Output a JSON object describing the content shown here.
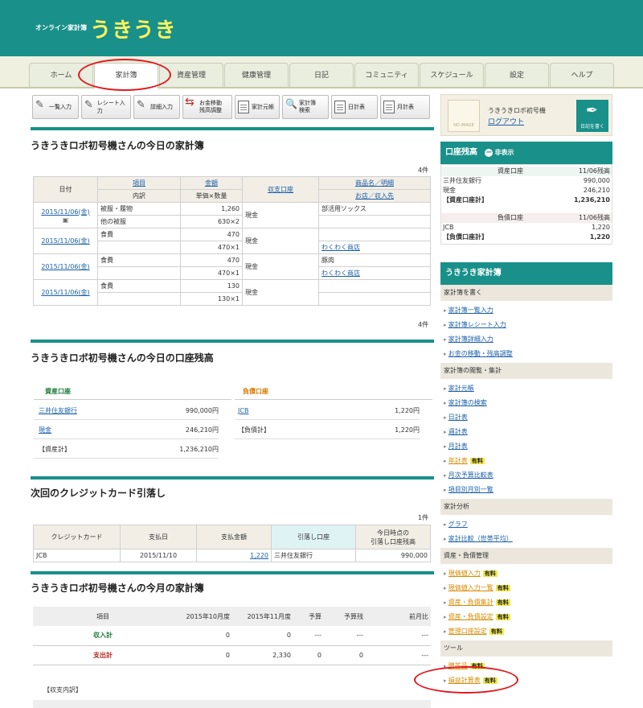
{
  "header": {
    "sub": "オンライン家計簿",
    "logo": "うきうき"
  },
  "nav": [
    "ホーム",
    "家計簿",
    "資産管理",
    "健康管理",
    "日記",
    "コミュニティ",
    "スケジュール",
    "設定",
    "ヘルプ"
  ],
  "toolbar": [
    "一覧入力",
    "レシート入力",
    "詳細入力",
    "お金移動\n残高調整",
    "家計元帳",
    "家計簿\n検索",
    "日計表",
    "月計表"
  ],
  "profile": {
    "no_image": "NO IMAGE",
    "name": "うきうきロボ初号機",
    "logout": "ログアウト",
    "write_diary": "日記を書く"
  },
  "today": {
    "title": "うきうきロボ初号機さんの今日の家計簿",
    "count": "4件",
    "headers": {
      "date": "日付",
      "item": "項目",
      "detail": "内訳",
      "amount": "金額",
      "unit": "単価×数量",
      "account": "収支口座",
      "product": "商品名／明細",
      "store": "お店／収入先"
    },
    "rows": [
      {
        "date": "2015/11/06(金)",
        "item": "被服・履物",
        "detail": "他の被服",
        "amount": "1,260",
        "unit": "630×2",
        "account": "現金",
        "product": "部活用ソックス",
        "store": ""
      },
      {
        "date": "2015/11/06(金)",
        "item": "食費",
        "detail": "",
        "amount": "470",
        "unit": "470×1",
        "account": "現金",
        "product": "",
        "store": "わくわく商店"
      },
      {
        "date": "2015/11/06(金)",
        "item": "食費",
        "detail": "",
        "amount": "470",
        "unit": "470×1",
        "account": "現金",
        "product": "豚肉",
        "store": "わくわく商店"
      },
      {
        "date": "2015/11/06(金)",
        "item": "食費",
        "detail": "",
        "amount": "130",
        "unit": "130×1",
        "account": "現金",
        "product": "",
        "store": ""
      }
    ]
  },
  "balance": {
    "title": "うきうきロボ初号機さんの今日の口座残高",
    "assets_head": "資産口座",
    "liab_head": "負債口座",
    "assets": [
      {
        "name": "三井住友銀行",
        "value": "990,000円"
      },
      {
        "name": "現金",
        "value": "246,210円"
      }
    ],
    "assets_total": {
      "name": "【資産計】",
      "value": "1,236,210円"
    },
    "liabs": [
      {
        "name": "JCB",
        "value": "1,220円"
      }
    ],
    "liabs_total": {
      "name": "【負債計】",
      "value": "1,220円"
    }
  },
  "credit": {
    "title": "次回のクレジットカード引落し",
    "count": "1件",
    "headers": [
      "クレジットカード",
      "支払日",
      "支払金額",
      "引落し口座",
      "今日時点の\n引落し口座残高"
    ],
    "row": [
      "JCB",
      "2015/11/10",
      "1,220",
      "三井住友銀行",
      "990,000"
    ]
  },
  "monthly": {
    "title": "うきうきロボ初号機さんの今月の家計簿",
    "headers": [
      "項目",
      "2015年10月度",
      "2015年11月度",
      "予算",
      "予算残",
      "前月比"
    ],
    "rows": [
      [
        "収入計",
        "0",
        "0",
        "---",
        "---",
        "---"
      ],
      [
        "支出計",
        "0",
        "2,330",
        "0",
        "0",
        "---"
      ]
    ],
    "breakdown": "【収支内訳】"
  },
  "sidebar_balance": {
    "title": "口座残高",
    "toggle": "非表示",
    "asset_head": [
      "資産口座",
      "11/06残高"
    ],
    "assets": [
      [
        "三井住友銀行",
        "990,000"
      ],
      [
        "現金",
        "246,210"
      ]
    ],
    "asset_total": [
      "【資産口座計】",
      "1,236,210"
    ],
    "liab_head": [
      "負債口座",
      "11/06残高"
    ],
    "liabs": [
      [
        "JCB",
        "1,220"
      ]
    ],
    "liab_total": [
      "【負債口座計】",
      "1,220"
    ]
  },
  "sidebar_menu": {
    "title": "うきうき家計簿",
    "groups": [
      {
        "cat": "家計簿を書く",
        "items": [
          {
            "label": "家計簿一覧入力"
          },
          {
            "label": "家計簿レシート入力"
          },
          {
            "label": "家計簿詳細入力"
          },
          {
            "label": "お金の移動・残高調整"
          }
        ]
      },
      {
        "cat": "家計簿の閲覧・集計",
        "items": [
          {
            "label": "家計元帳"
          },
          {
            "label": "家計簿の検索"
          },
          {
            "label": "日計表"
          },
          {
            "label": "週計表"
          },
          {
            "label": "月計表"
          },
          {
            "label": "年計表",
            "paid": "有料"
          },
          {
            "label": "月次予算比較表"
          },
          {
            "label": "項目別月別一覧"
          }
        ]
      },
      {
        "cat": "家計分析",
        "items": [
          {
            "label": "グラフ"
          },
          {
            "label": "家計比較（世帯平均）"
          }
        ]
      },
      {
        "cat": "資産・負債管理",
        "items": [
          {
            "label": "現価値入力",
            "paid": "有料"
          },
          {
            "label": "現価値入力一覧",
            "paid": "有料"
          },
          {
            "label": "資産・負債集計",
            "paid": "有料"
          },
          {
            "label": "資産・負債設定",
            "paid": "有料"
          },
          {
            "label": "管理口座設定",
            "paid": "有料"
          }
        ]
      },
      {
        "cat": "ツール",
        "items": [
          {
            "label": "贈答品",
            "paid": "有料"
          },
          {
            "label": "損益計算表",
            "paid": "有料"
          }
        ]
      }
    ]
  }
}
